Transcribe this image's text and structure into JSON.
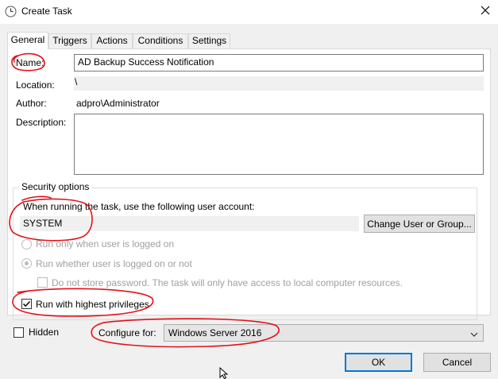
{
  "window": {
    "title": "Create Task",
    "icon": "clock-icon",
    "close_icon": "close-icon"
  },
  "tabs": [
    {
      "label": "General",
      "active": true
    },
    {
      "label": "Triggers"
    },
    {
      "label": "Actions"
    },
    {
      "label": "Conditions"
    },
    {
      "label": "Settings"
    }
  ],
  "general": {
    "name_label": "Name:",
    "name_value": "AD Backup Success Notification",
    "location_label": "Location:",
    "location_value": "\\",
    "author_label": "Author:",
    "author_value": "adpro\\Administrator",
    "description_label": "Description:",
    "description_value": ""
  },
  "security": {
    "group_title": "Security options",
    "account_prompt": "When running the task, use the following user account:",
    "account_value": "SYSTEM",
    "change_user_button": "Change User or Group...",
    "radio_logged_on": "Run only when user is logged on",
    "radio_logged_on_or_not": "Run whether user is logged on or not",
    "no_store_password": "Do not store password.  The task will only have access to local computer resources.",
    "highest_privileges": "Run with highest privileges"
  },
  "footer": {
    "hidden_label": "Hidden",
    "configure_label": "Configure for:",
    "configure_value": "Windows Server 2016",
    "ok_button": "OK",
    "cancel_button": "Cancel"
  },
  "colors": {
    "annotation": "#e0131a",
    "default_button_border": "#0078d7"
  }
}
